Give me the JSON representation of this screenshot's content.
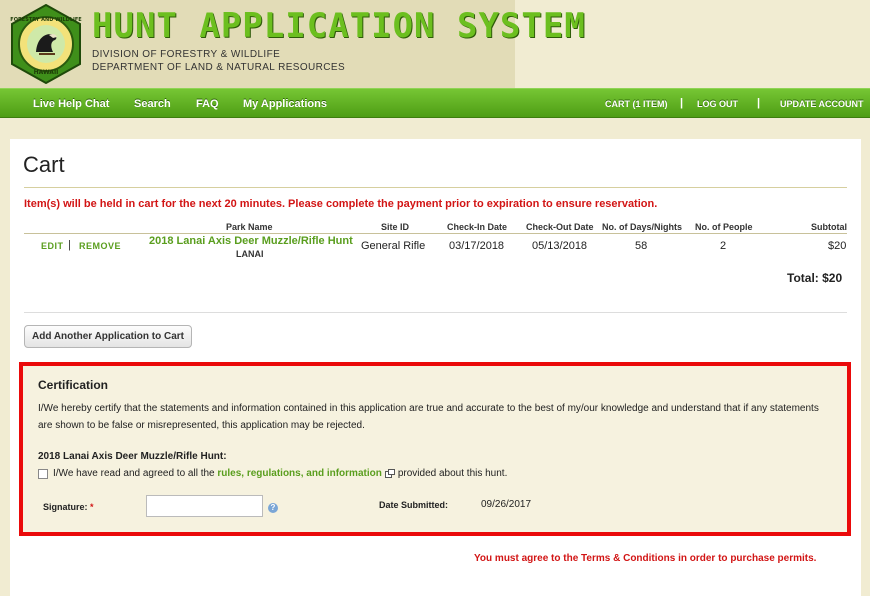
{
  "header": {
    "logo_text": "FORESTRY AND WILDLIFE HAWAII",
    "title": "HUNT APPLICATION SYSTEM",
    "division": "DIVISION OF FORESTRY & WILDLIFE",
    "department": "DEPARTMENT OF LAND & NATURAL RESOURCES",
    "colors": {
      "brand_green": "#6cbf1f",
      "nav_green": "#5ead22",
      "alert_red": "#d21515"
    }
  },
  "nav": {
    "left": [
      "Live Help Chat",
      "Search",
      "FAQ",
      "My Applications"
    ],
    "right": [
      "CART (1 ITEM)",
      "LOG OUT",
      "UPDATE ACCOUNT"
    ],
    "separator": "|"
  },
  "cart": {
    "title": "Cart",
    "hold_message": "Item(s) will be held in cart for the next 20 minutes. Please complete the payment prior to expiration to ensure reservation.",
    "columns": [
      "Park Name",
      "Site ID",
      "Check-In Date",
      "Check-Out Date",
      "No. of Days/Nights",
      "No. of People",
      "Subtotal"
    ],
    "row": {
      "edit": "EDIT",
      "sep": "|",
      "remove": "REMOVE",
      "park_name": "2018 Lanai Axis Deer Muzzle/Rifle Hunt",
      "park_sub": "LANAI",
      "site_id": "General Rifle",
      "check_in": "03/17/2018",
      "check_out": "05/13/2018",
      "days_nights": "58",
      "people": "2",
      "subtotal": "$20"
    },
    "total": "Total: $20",
    "add_button": "Add Another Application to Cart"
  },
  "certification": {
    "title": "Certification",
    "text": "I/We hereby certify that the statements and information contained in this application are true and accurate to the best of my/our knowledge and understand that if any statements are shown to be false or misrepresented, this application may be rejected.",
    "hunt_title": "2018 Lanai Axis Deer Muzzle/Rifle Hunt:",
    "agree_prefix": "I/We have read and agreed to all the",
    "agree_link": "rules, regulations, and information",
    "agree_suffix": "provided about this hunt.",
    "agree_checked": false,
    "signature_label": "Signature:",
    "required_mark": "*",
    "signature_value": "",
    "date_label": "Date Submitted:",
    "date_value": "09/26/2017"
  },
  "terms_message": "You must agree to the Terms & Conditions in order to purchase permits."
}
